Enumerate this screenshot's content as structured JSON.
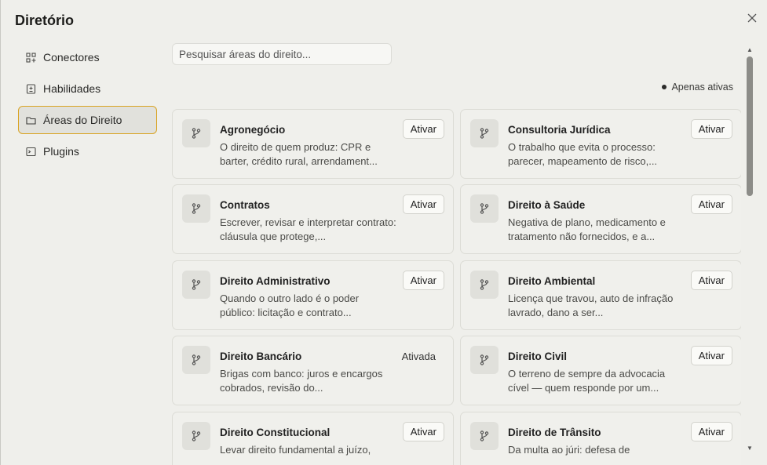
{
  "dialog": {
    "title": "Diretório",
    "close_icon": "close-icon"
  },
  "sidebar": {
    "items": [
      {
        "label": "Conectores",
        "icon": "grid-plus-icon"
      },
      {
        "label": "Habilidades",
        "icon": "document-plus-icon"
      },
      {
        "label": "Áreas do Direito",
        "icon": "folder-icon",
        "active": true
      },
      {
        "label": "Plugins",
        "icon": "terminal-icon"
      }
    ]
  },
  "search": {
    "placeholder": "Pesquisar áreas do direito..."
  },
  "filter": {
    "label": "Apenas ativas"
  },
  "cards": [
    {
      "name": "Agronegócio",
      "desc": "O direito de quem produz: CPR e barter, crédito rural, arrendament...",
      "action": "Ativar"
    },
    {
      "name": "Consultoria Jurídica",
      "desc": "O trabalho que evita o processo: parecer, mapeamento de risco,...",
      "action": "Ativar"
    },
    {
      "name": "Contratos",
      "desc": "Escrever, revisar e interpretar contrato: cláusula que protege,...",
      "action": "Ativar"
    },
    {
      "name": "Direito à Saúde",
      "desc": "Negativa de plano, medicamento e tratamento não fornecidos, e a...",
      "action": "Ativar"
    },
    {
      "name": "Direito Administrativo",
      "desc": "Quando o outro lado é o poder público: licitação e contrato...",
      "action": "Ativar"
    },
    {
      "name": "Direito Ambiental",
      "desc": "Licença que travou, auto de infração lavrado, dano a ser...",
      "action": "Ativar"
    },
    {
      "name": "Direito Bancário",
      "desc": "Brigas com banco: juros e encargos cobrados, revisão do...",
      "status": "Ativada"
    },
    {
      "name": "Direito Civil",
      "desc": "O terreno de sempre da advocacia cível — quem responde por um...",
      "action": "Ativar"
    },
    {
      "name": "Direito Constitucional",
      "desc": "Levar direito fundamental a juízo,",
      "action": "Ativar"
    },
    {
      "name": "Direito de Trânsito",
      "desc": "Da multa ao júri: defesa de",
      "action": "Ativar"
    }
  ],
  "colors": {
    "accent": "#d9a321",
    "background": "#efefeb"
  }
}
